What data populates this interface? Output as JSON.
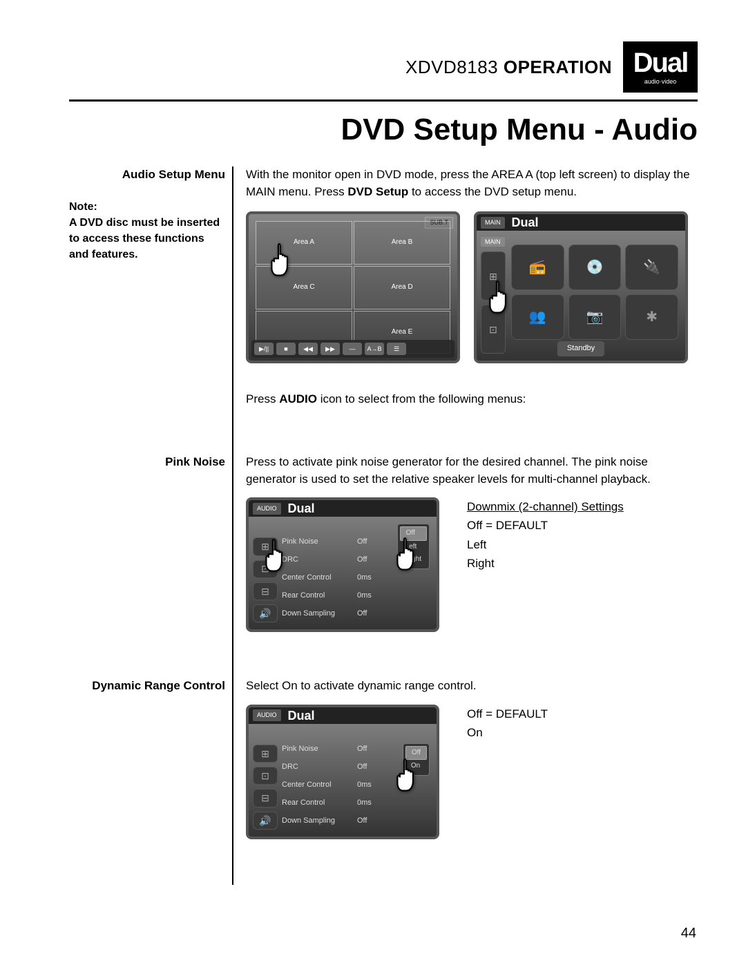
{
  "header": {
    "model": "XDVD8183",
    "operation": "OPERATION",
    "logo_main": "Dual",
    "logo_sub": "audio·video"
  },
  "page_title": "DVD Setup Menu - Audio",
  "page_number": "44",
  "sections": {
    "audio_setup": {
      "label": "Audio Setup Menu",
      "note_title": "Note:",
      "note_body": "A DVD disc must be inserted to access these functions and features.",
      "body_pre": "With the monitor open in DVD mode, press the AREA A (top left screen) to display the MAIN menu. Press ",
      "body_bold": "DVD Setup",
      "body_post": " to access the DVD setup menu.",
      "screenshot1": {
        "areas": [
          "Area A",
          "Area B",
          "Area C",
          "Area D",
          "",
          "Area E"
        ],
        "subt": "SUB.T",
        "controls": [
          "▶/||",
          "■",
          "◀◀",
          "▶▶",
          "—",
          "A→B",
          "☰"
        ]
      },
      "screenshot2": {
        "tab_main": "MAIN",
        "tab_main2": "MAIN",
        "standby": "Standby",
        "icons": [
          "📻",
          "💿",
          "🔌",
          "👥",
          "📷",
          "✱"
        ]
      },
      "press_audio_pre": "Press ",
      "press_audio_bold": "AUDIO",
      "press_audio_post": " icon to select from the following menus:"
    },
    "pink_noise": {
      "label": "Pink Noise",
      "body": "Press to activate pink noise generator for the desired channel. The pink noise generator is used to set the relative speaker levels for multi-channel playback.",
      "menu": {
        "title": "AUDIO",
        "rows": [
          {
            "k": "Pink Noise",
            "v": "Off"
          },
          {
            "k": "DRC",
            "v": "Off"
          },
          {
            "k": "Center Control",
            "v": "0ms"
          },
          {
            "k": "Rear Control",
            "v": "0ms"
          },
          {
            "k": "Down Sampling",
            "v": "Off"
          }
        ],
        "popup": [
          "Off",
          "Left",
          "Right"
        ]
      },
      "settings_title": "Downmix (2-channel) Settings",
      "settings": [
        "Off = DEFAULT",
        "Left",
        "Right"
      ]
    },
    "drc": {
      "label": "Dynamic Range Control",
      "body": "Select On to activate dynamic range control.",
      "menu": {
        "title": "AUDIO",
        "rows": [
          {
            "k": "Pink Noise",
            "v": "Off"
          },
          {
            "k": "DRC",
            "v": "Off"
          },
          {
            "k": "Center Control",
            "v": "0ms"
          },
          {
            "k": "Rear Control",
            "v": "0ms"
          },
          {
            "k": "Down Sampling",
            "v": "Off"
          }
        ],
        "popup": [
          "Off",
          "On"
        ]
      },
      "settings": [
        "Off = DEFAULT",
        "On"
      ]
    }
  }
}
